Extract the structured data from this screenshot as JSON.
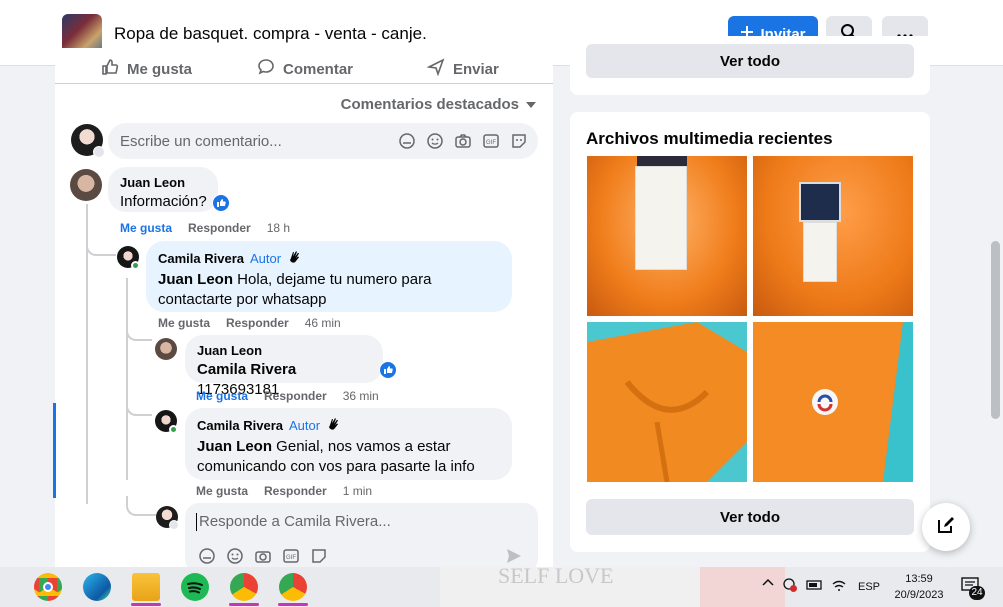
{
  "header": {
    "group_name": "Ropa de basquet. compra - venta - canje.",
    "invite_label": "Invitar",
    "search_icon": "search-icon",
    "more_icon": "more-icon"
  },
  "post_actions": {
    "like": "Me gusta",
    "comment": "Comentar",
    "send": "Enviar"
  },
  "comments_sort": "Comentarios destacados",
  "composer": {
    "placeholder": "Escribe un comentario..."
  },
  "comments": [
    {
      "author": "Juan Leon",
      "text": "Información?",
      "like_label": "Me gusta",
      "reply_label": "Responder",
      "time": "18 h"
    },
    {
      "author": "Camila Rivera",
      "badge": "Autor",
      "mention": "Juan Leon",
      "text": " Hola, dejame tu numero para contactarte por whatsapp",
      "like_label": "Me gusta",
      "reply_label": "Responder",
      "time": "46 min"
    },
    {
      "author": "Juan Leon",
      "mention": "Camila Rivera",
      "text": " 1173693181",
      "like_label": "Me gusta",
      "reply_label": "Responder",
      "time": "36 min"
    },
    {
      "author": "Camila Rivera",
      "badge": "Autor",
      "mention": "Juan Leon",
      "text": " Genial, nos vamos a estar comunicando con vos para pasarte la info",
      "like_label": "Me gusta",
      "reply_label": "Responder",
      "time": "1 min"
    }
  ],
  "reply_composer": {
    "placeholder": "Responde a Camila Rivera..."
  },
  "sidebar": {
    "top_button": "Ver todo",
    "media_title": "Archivos multimedia recientes",
    "media_button": "Ver todo"
  },
  "taskbar": {
    "language": "ESP",
    "time": "13:59",
    "date": "20/9/2023",
    "notifications": "24",
    "wallpaper_text": "SELF LOVE"
  },
  "colors": {
    "accent": "#1b74e4",
    "background": "#f0f2f5"
  }
}
